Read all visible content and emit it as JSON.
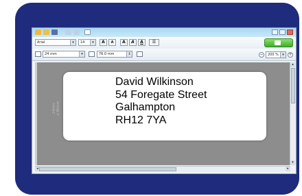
{
  "toolbar": {
    "font_name": "Arial",
    "font_size": "14",
    "label_width": "24 mm",
    "label_length": "76.0 mm",
    "zoom_level": "200 %",
    "font_grow_label": "A",
    "font_shrink_label": "A",
    "bold_label": "A",
    "italic_label": "A",
    "underline_label": "A",
    "zoom_out_label": "−",
    "zoom_in_label": "+",
    "colors": {
      "print_button": "#3fae2c",
      "frame": "#1f2b7c",
      "canvas": "#8d8d8d"
    }
  },
  "label": {
    "dimensions_line1": "24mm",
    "dimensions_line2": "x 90mm",
    "address_lines": [
      "David Wilkinson",
      "54 Foregate Street",
      "Galhampton",
      "RH12 7YA"
    ]
  }
}
